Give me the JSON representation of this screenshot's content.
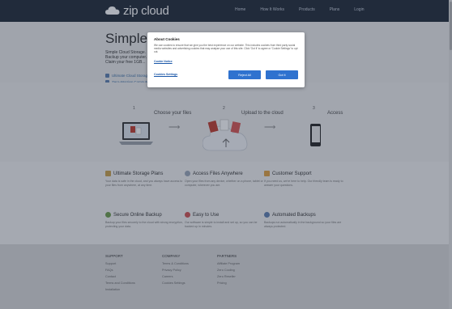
{
  "header": {
    "logo_text": "zip cloud",
    "nav": [
      "Home",
      "How It Works",
      "Products",
      "Plans",
      "Login"
    ]
  },
  "hero": {
    "title": "Simple.",
    "subtitle": "Simple Cloud Storage. Backup your computer. Claim your free 1GB...",
    "links": [
      "Ultimate Cloud Storage",
      "Zero-Worries Compute"
    ]
  },
  "steps": [
    {
      "num": "1",
      "label": "Choose your files"
    },
    {
      "num": "2",
      "label": "Upload to the cloud"
    },
    {
      "num": "3",
      "label": "Access"
    }
  ],
  "features": [
    {
      "title": "Ultimate Storage Plans",
      "icon": "storage-icon",
      "color": "#c9a04a",
      "desc": "Your data is safe in the cloud, and you always have access to your files from anywhere, at any time."
    },
    {
      "title": "Access Files Anywhere",
      "icon": "globe-icon",
      "color": "#9aa7b8",
      "desc": "Open your files from any device, whether on a phone, tablet or computer, wherever you are."
    },
    {
      "title": "Customer Support",
      "icon": "support-icon",
      "color": "#e0a040",
      "desc": "If you need us, we're here to help. Our friendly team is ready to answer your questions."
    },
    {
      "title": "Secure Online Backup",
      "icon": "shield-icon",
      "color": "#6b9b4a",
      "desc": "Backup your files securely to the cloud with strong encryption, protecting your data."
    },
    {
      "title": "Easy to Use",
      "icon": "heart-icon",
      "color": "#d05050",
      "desc": "Our software is simple to install and set up, so you can be backed up in minutes."
    },
    {
      "title": "Automated Backups",
      "icon": "refresh-icon",
      "color": "#5c7fb0",
      "desc": "Backups run automatically in the background so your files are always protected."
    }
  ],
  "footer": {
    "columns": [
      {
        "title": "SUPPORT",
        "items": [
          "Support",
          "FAQs",
          "Contact",
          "Terms and Conditions",
          "Installation"
        ]
      },
      {
        "title": "COMPANY",
        "items": [
          "Terms & Conditions",
          "Privacy Policy",
          "Careers",
          "Cookies Settings"
        ]
      },
      {
        "title": "PARTNERS",
        "items": [
          "Affiliate Program",
          "Zero Cooling",
          "Zero Reseller",
          "Pricing"
        ]
      }
    ]
  },
  "cookie_modal": {
    "title": "About Cookies",
    "body": "We use cookies to ensure that we give you the best experience on our website. This includes cookies from third party social media websites and advertising cookies that may analyse your use of this site. Click 'Got it' to agree or 'Cookie Settings' to opt out.",
    "policy_link": "Cookie Notice",
    "settings_link": "Cookies Settings",
    "reject_label": "Reject All",
    "accept_label": "Got it"
  },
  "colors": {
    "accent": "#2f72cf",
    "header_bg": "#1e2735"
  }
}
